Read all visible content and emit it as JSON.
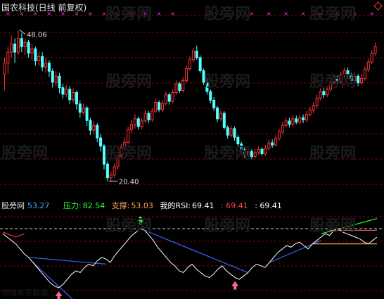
{
  "window": {
    "title": "国农科技(日线 前复权)"
  },
  "watermark": {
    "text": "股旁网"
  },
  "main_chart": {
    "high_label": "48.06",
    "low_label": "20.40",
    "ylim": [
      18,
      52
    ],
    "candles": [
      [
        40,
        42,
        37,
        43
      ],
      [
        42,
        44,
        40,
        45
      ],
      [
        44,
        45.5,
        43,
        47
      ],
      [
        45.5,
        44,
        42,
        46.5
      ],
      [
        44,
        46.5,
        43.5,
        48.06
      ],
      [
        46.5,
        45,
        44,
        47.5
      ],
      [
        45,
        45.8,
        43.5,
        46.5
      ],
      [
        45.8,
        43.8,
        43,
        46.2
      ],
      [
        43.8,
        44.6,
        42.5,
        45.5
      ],
      [
        44.6,
        42.4,
        41.5,
        45
      ],
      [
        42.4,
        43.2,
        41.5,
        44
      ],
      [
        43.2,
        41.3,
        40.5,
        44
      ],
      [
        41.3,
        42,
        40.2,
        43
      ],
      [
        42,
        40.5,
        39.5,
        42.5
      ],
      [
        40.5,
        38.5,
        37.5,
        41
      ],
      [
        38.5,
        39.6,
        37.8,
        40.5
      ],
      [
        39.6,
        37.5,
        36.5,
        40.2
      ],
      [
        37.5,
        36.3,
        35.5,
        38.2
      ],
      [
        36.3,
        37.2,
        35.8,
        38
      ],
      [
        37.2,
        35.3,
        34.5,
        37.8
      ],
      [
        35.3,
        36.6,
        34.8,
        37.4
      ],
      [
        36.6,
        34.5,
        33.5,
        37
      ],
      [
        34.5,
        33,
        32,
        35.2
      ],
      [
        33,
        33.8,
        32.5,
        34.6
      ],
      [
        33.8,
        31.5,
        30.5,
        34.2
      ],
      [
        31.5,
        29.7,
        28.8,
        32
      ],
      [
        29.7,
        30.6,
        29,
        31.4
      ],
      [
        30.6,
        28.3,
        27.5,
        31
      ],
      [
        28.3,
        26.8,
        25.8,
        29
      ],
      [
        26.8,
        23.5,
        22.5,
        27.2
      ],
      [
        23.5,
        21,
        20.4,
        24
      ],
      [
        21,
        21.5,
        20.4,
        22.2
      ],
      [
        21.5,
        23,
        21,
        23.6
      ],
      [
        23,
        25,
        22.6,
        25.6
      ],
      [
        25,
        26.6,
        24.6,
        27.2
      ],
      [
        26.6,
        27.5,
        26,
        28.4
      ],
      [
        27.5,
        29.8,
        27.2,
        30.4
      ],
      [
        29.8,
        30.8,
        29.3,
        31.6
      ],
      [
        30.8,
        31.8,
        30,
        32.6
      ],
      [
        31.8,
        30.4,
        29.8,
        32.2
      ],
      [
        30.4,
        31.4,
        30,
        32
      ],
      [
        31.4,
        32.8,
        31,
        33.4
      ],
      [
        32.8,
        31.6,
        31,
        33.2
      ],
      [
        31.6,
        33.2,
        31.2,
        33.8
      ],
      [
        33.2,
        34.8,
        32.8,
        35.4
      ],
      [
        34.8,
        33.5,
        33,
        35.2
      ],
      [
        33.5,
        34.6,
        33,
        35.2
      ],
      [
        34.6,
        36.2,
        34.2,
        36.8
      ],
      [
        36.2,
        35,
        34.4,
        36.6
      ],
      [
        35,
        36.6,
        34.6,
        37.2
      ],
      [
        36.6,
        38.2,
        36.2,
        38.8
      ],
      [
        38.2,
        37,
        36.5,
        38.6
      ],
      [
        37,
        38.8,
        36.6,
        39.5
      ],
      [
        38.8,
        41,
        38.4,
        41.6
      ],
      [
        41,
        42.6,
        40.6,
        43.2
      ],
      [
        42.6,
        44.2,
        42.2,
        44.8
      ],
      [
        44.2,
        43,
        42.6,
        45.2
      ],
      [
        43,
        40.6,
        40.2,
        43.4
      ],
      [
        40.6,
        38.5,
        38,
        41
      ],
      [
        38.5,
        36.8,
        36.2,
        39
      ],
      [
        36.8,
        35.2,
        34.6,
        37.2
      ],
      [
        35.2,
        33.8,
        33.2,
        35.8
      ],
      [
        33.8,
        31.8,
        31.2,
        34.2
      ],
      [
        31.8,
        32.8,
        31.4,
        33.4
      ],
      [
        32.8,
        30.2,
        29.8,
        33.2
      ],
      [
        30.2,
        28.8,
        28.2,
        30.6
      ],
      [
        28.8,
        30,
        28.4,
        30.6
      ],
      [
        30,
        28.4,
        27.8,
        30.4
      ],
      [
        28.4,
        27.2,
        26.6,
        28.8
      ],
      [
        27.2,
        26.2,
        25.6,
        27.6
      ],
      [
        26.2,
        25.3,
        24.6,
        26.6
      ],
      [
        25.3,
        25.8,
        24.6,
        26.4
      ],
      [
        25.8,
        24.9,
        24.4,
        26.2
      ],
      [
        24.9,
        25.6,
        24.6,
        26.2
      ],
      [
        25.6,
        26.2,
        25.2,
        26.8
      ],
      [
        26.2,
        25.4,
        25,
        26.6
      ],
      [
        25.4,
        26.4,
        25,
        27
      ],
      [
        26.4,
        27.4,
        26,
        28
      ],
      [
        27.4,
        27,
        26.5,
        28
      ],
      [
        27,
        28.2,
        26.8,
        28.8
      ],
      [
        28.2,
        29.4,
        27.8,
        30
      ],
      [
        29.4,
        30.6,
        29,
        31.2
      ],
      [
        30.6,
        31.4,
        30.2,
        32
      ],
      [
        31.4,
        30.8,
        30.2,
        32
      ],
      [
        30.8,
        31.8,
        30.4,
        32.4
      ],
      [
        31.8,
        31.2,
        30.8,
        32.4
      ],
      [
        31.2,
        32,
        30.8,
        32.6
      ],
      [
        32,
        31.6,
        31,
        32.6
      ],
      [
        31.6,
        32.6,
        31.2,
        33.2
      ],
      [
        32.6,
        33.4,
        32.2,
        34
      ],
      [
        33.4,
        34.2,
        32.8,
        34.8
      ],
      [
        34.2,
        35.6,
        33.8,
        36.2
      ],
      [
        35.6,
        36.8,
        35.2,
        37.4
      ],
      [
        36.8,
        36.2,
        35.6,
        37.4
      ],
      [
        36.2,
        37.2,
        35.8,
        37.8
      ],
      [
        37.2,
        38.4,
        36.8,
        39
      ],
      [
        38.4,
        39.2,
        38,
        39.8
      ],
      [
        39.2,
        38.6,
        38,
        39.8
      ],
      [
        38.6,
        39.8,
        38.2,
        40.4
      ],
      [
        39.8,
        40.6,
        39.4,
        41.2
      ],
      [
        40.6,
        39.8,
        39.2,
        41.2
      ],
      [
        39.8,
        38.8,
        38.2,
        40.2
      ],
      [
        38.8,
        39.6,
        38.4,
        40.2
      ],
      [
        39.6,
        38.4,
        37.8,
        40
      ],
      [
        38.4,
        39.2,
        38,
        40
      ],
      [
        39.2,
        40.8,
        38.8,
        41.4
      ],
      [
        40.8,
        42.2,
        40.4,
        42.8
      ],
      [
        42.2,
        43.8,
        41.8,
        44.4
      ],
      [
        43.8,
        45,
        43.4,
        45.8
      ]
    ],
    "bull_color": "#ff3333",
    "bear_color": "#54ffff",
    "marker_color": "#ff33ff",
    "grid_color": "#8b0000"
  },
  "indicator": {
    "legend_name": "股旁网",
    "legend_value": "53.27",
    "pressure_label": "压力:",
    "pressure_value": "82.54",
    "support_label": "支撑:",
    "support_value": "53.03",
    "rsi_label": "我的RSI:",
    "rsi_value": "69.41",
    "extra_value_1": ": 69.41",
    "extra_value_2": ": 69.41",
    "rsi_series": [
      74,
      70,
      66,
      62,
      56,
      50,
      46,
      40,
      34,
      28,
      22,
      16,
      12,
      10,
      14,
      20,
      26,
      30,
      28,
      34,
      38,
      36,
      42,
      46,
      44,
      40,
      48,
      54,
      60,
      66,
      72,
      76,
      80,
      78,
      72,
      66,
      58,
      52,
      46,
      40,
      36,
      30,
      28,
      34,
      38,
      32,
      28,
      24,
      22,
      26,
      32,
      36,
      30,
      26,
      22,
      20,
      24,
      28,
      34,
      38,
      36,
      34,
      40,
      46,
      52,
      56,
      60,
      58,
      62,
      64,
      60,
      56,
      62,
      66,
      70,
      74,
      72,
      78,
      80,
      76,
      74,
      72,
      70,
      68,
      64,
      62,
      66,
      70
    ],
    "ylim": [
      0,
      100
    ],
    "resistance_level": 80,
    "trendline_color": "#3366ff",
    "rsi_color": "#ffffff",
    "upper_line_color": "#33ff33",
    "lower_line_color": "#ffaa55",
    "arrow_up_color": "#ff6699",
    "arrow_down_color": "#33ff33",
    "footer_text": "用钱来买数据"
  }
}
